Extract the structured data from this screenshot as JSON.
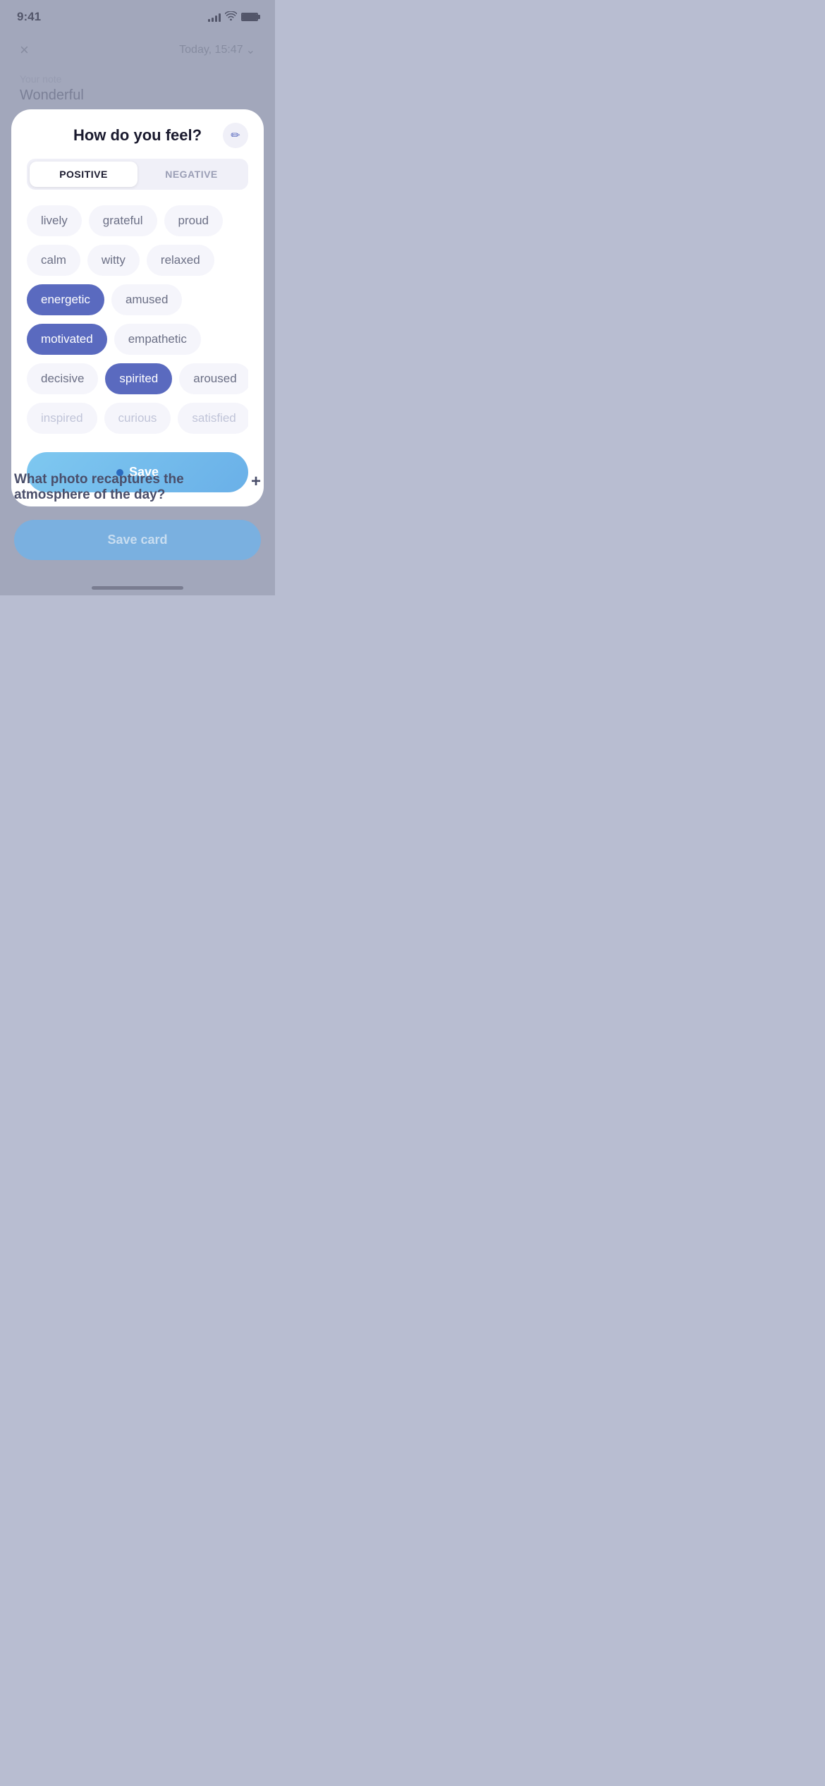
{
  "statusBar": {
    "time": "9:41",
    "signalBars": [
      4,
      6,
      9,
      11,
      14
    ],
    "batteryFull": true
  },
  "background": {
    "closeLabel": "×",
    "dateLabel": "Today, 15:47",
    "chevronLabel": "⌄",
    "noteLabel": "Your note",
    "noteValue": "Wonderful"
  },
  "modal": {
    "title": "How do you feel?",
    "editIconLabel": "✏",
    "tabs": [
      {
        "id": "positive",
        "label": "POSITIVE",
        "active": true
      },
      {
        "id": "negative",
        "label": "NEGATIVE",
        "active": false
      }
    ],
    "feelings": [
      {
        "label": "lively",
        "selected": false,
        "faded": false
      },
      {
        "label": "grateful",
        "selected": false,
        "faded": false
      },
      {
        "label": "proud",
        "selected": false,
        "faded": false
      },
      {
        "label": "calm",
        "selected": false,
        "faded": false
      },
      {
        "label": "witty",
        "selected": false,
        "faded": false
      },
      {
        "label": "relaxed",
        "selected": false,
        "faded": false
      },
      {
        "label": "energetic",
        "selected": true,
        "faded": false
      },
      {
        "label": "amused",
        "selected": false,
        "faded": false
      },
      {
        "label": "motivated",
        "selected": true,
        "faded": false
      },
      {
        "label": "empathetic",
        "selected": false,
        "faded": false
      },
      {
        "label": "decisive",
        "selected": false,
        "faded": false
      },
      {
        "label": "spirited",
        "selected": true,
        "faded": false
      },
      {
        "label": "aroused",
        "selected": false,
        "faded": false
      },
      {
        "label": "inspired",
        "selected": false,
        "faded": true
      },
      {
        "label": "curious",
        "selected": false,
        "faded": true
      },
      {
        "label": "satisfied",
        "selected": false,
        "faded": true
      }
    ],
    "saveLabel": "Save",
    "accentColor": "#5a6abf",
    "saveBtnColor": "#7ec8f0"
  },
  "bottomSection": {
    "photoQuestion": "What photo recaptures the\natmosphere of the day?",
    "plusIcon": "+",
    "saveCardLabel": "Save card"
  }
}
